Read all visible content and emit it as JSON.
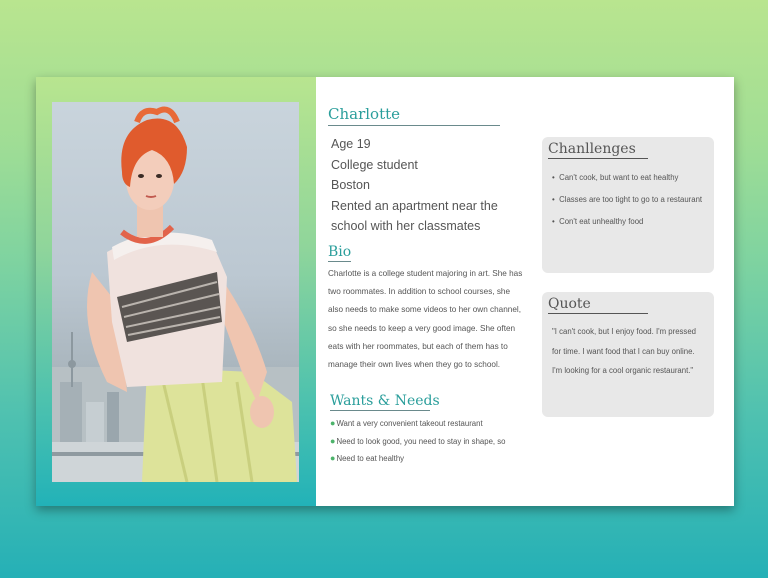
{
  "persona": {
    "name": "Charlotte",
    "profile_lines": [
      "Age  19",
      "College student",
      "Boston",
      "Rented an apartment near the",
      "school with her classmates"
    ],
    "photo_icon": "persona-portrait"
  },
  "bio": {
    "heading": "Bio",
    "lines": [
      "Charlotte is a college student majoring in art. She has",
      "two roommates. In addition to school courses, she",
      "also needs to make some videos to her own channel,",
      "so she needs to keep a very good image. She often",
      "eats with her roommates, but each of them has to",
      "manage their own lives when they go to school."
    ]
  },
  "wants": {
    "heading": "Wants & Needs",
    "bullet": "●",
    "items": [
      "Want a very convenient takeout restaurant",
      "Need to look good, you need to stay in shape, so",
      "Need to eat healthy"
    ]
  },
  "challenges": {
    "heading": "Chanllenges",
    "bullet": "•",
    "items": [
      "Can't cook, but want to eat healthy",
      "Classes are too tight to go to a restaurant",
      "Con't eat unhealthy food"
    ]
  },
  "quote": {
    "heading": "Quote",
    "lines": [
      "\"I can't cook, but I enjoy food. I'm pressed",
      "for time. I want food that I can buy online.",
      "I'm looking for a cool organic restaurant.\""
    ]
  },
  "colors": {
    "accent": "#2a9e9b",
    "text": "#555555",
    "box": "#e8e8e8",
    "bullet_green": "#4db36b"
  }
}
